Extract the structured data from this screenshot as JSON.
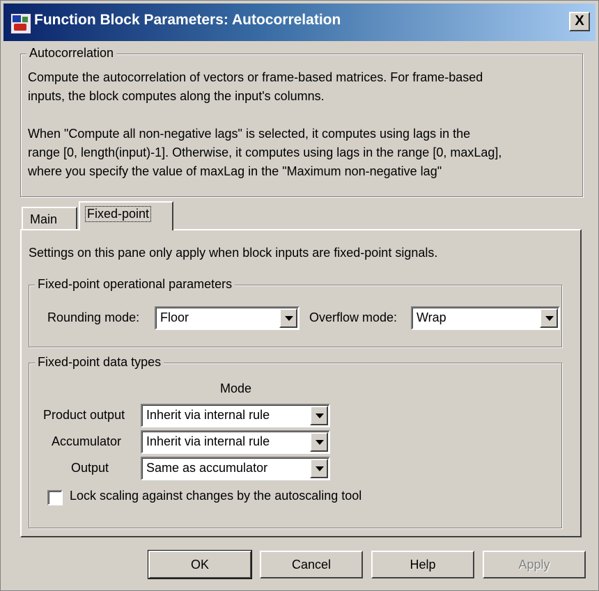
{
  "window": {
    "title": "Function Block Parameters: Autocorrelation",
    "close_label": "X"
  },
  "description": {
    "group_label": "Autocorrelation",
    "para1_line1": "Compute the autocorrelation of vectors or frame-based matrices. For frame-based",
    "para1_line2": "inputs, the block computes along the input's columns.",
    "para2_line1": "When \"Compute all non-negative lags\" is selected, it computes using lags in the",
    "para2_line2": "range [0, length(input)-1]. Otherwise, it computes using lags in the range [0, maxLag],",
    "para2_line3": "where you specify the value of maxLag in the \"Maximum non-negative lag\""
  },
  "tabs": [
    {
      "label": "Main"
    },
    {
      "label": "Fixed-point"
    }
  ],
  "fixed_point": {
    "note": "Settings on this pane only apply when block inputs are fixed-point signals.",
    "operational": {
      "group_label": "Fixed-point operational parameters",
      "rounding_label": "Rounding mode:",
      "rounding_value": "Floor",
      "overflow_label": "Overflow mode:",
      "overflow_value": "Wrap"
    },
    "data_types": {
      "group_label": "Fixed-point data types",
      "mode_header": "Mode",
      "rows": [
        {
          "label": "Product output",
          "value": "Inherit via internal rule"
        },
        {
          "label": "Accumulator",
          "value": "Inherit via internal rule"
        },
        {
          "label": "Output",
          "value": "Same as accumulator"
        }
      ],
      "lock_label": "Lock scaling against changes by the autoscaling tool",
      "lock_checked": false
    }
  },
  "buttons": {
    "ok": "OK",
    "cancel": "Cancel",
    "help": "Help",
    "apply": "Apply"
  }
}
